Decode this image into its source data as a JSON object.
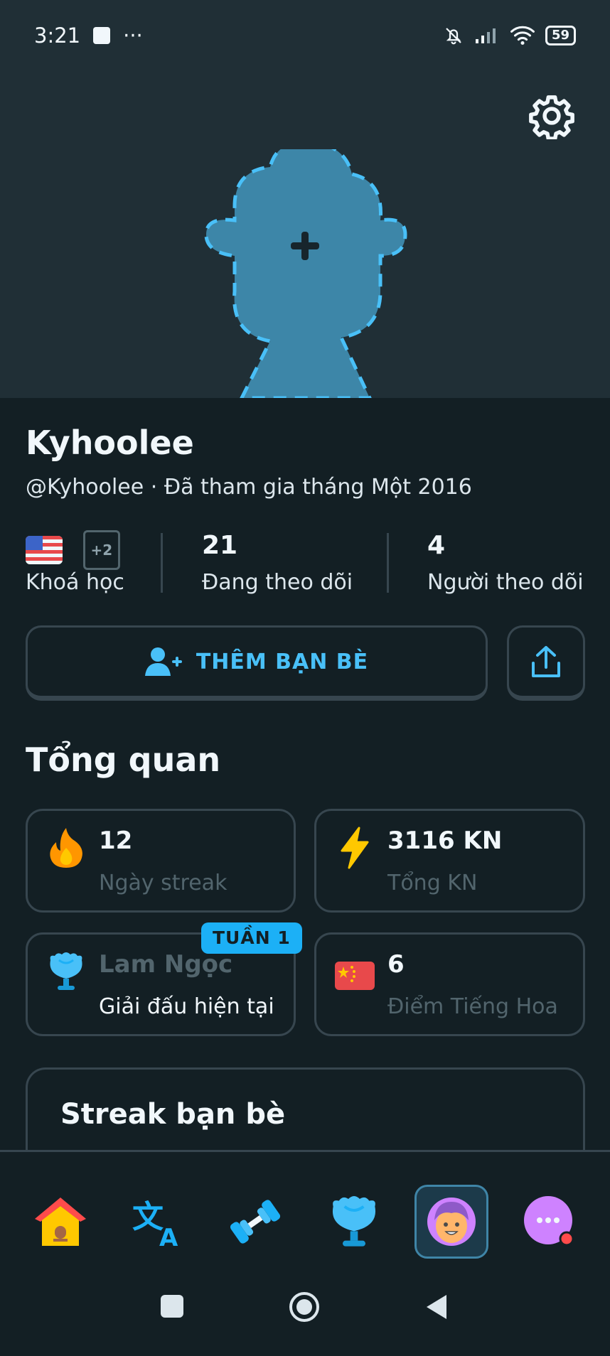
{
  "status_bar": {
    "time": "3:21",
    "dots": "···",
    "battery": "59"
  },
  "profile": {
    "display_name": "Kyhoolee",
    "handle_line": "@Kyhoolee · Đã tham gia tháng Một 2016",
    "courses_extra": "+2",
    "courses_label": "Khoá học",
    "following_count": "21",
    "following_label": "Đang theo dõi",
    "followers_count": "4",
    "followers_label": "Người theo dõi"
  },
  "actions": {
    "add_friends_label": "THÊM BẠN BÈ"
  },
  "overview": {
    "title": "Tổng quan",
    "cards": [
      {
        "value": "12",
        "label": "Ngày streak",
        "icon": "fire-icon"
      },
      {
        "value": "3116 KN",
        "label": "Tổng KN",
        "icon": "lightning-icon"
      },
      {
        "value": "Lam Ngọc",
        "label": "Giải đấu hiện tại",
        "icon": "sapphire-trophy-icon",
        "badge": "TUẦN 1"
      },
      {
        "value": "6",
        "label": "Điểm Tiếng Hoa",
        "icon": "china-flag-icon"
      }
    ]
  },
  "friend_streak": {
    "title": "Streak bạn bè"
  },
  "nav": [
    "home-icon",
    "translate-icon",
    "dumbbell-icon",
    "league-icon",
    "profile-icon",
    "more-icon"
  ],
  "colors": {
    "accent": "#1CB0F6",
    "background": "#131F24",
    "border": "#37464F"
  }
}
